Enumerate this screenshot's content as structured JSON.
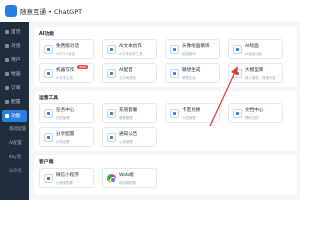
{
  "header": {
    "brand": "随意互通 • ChatGPT"
  },
  "sidebar": {
    "items": [
      {
        "label": "首页"
      },
      {
        "label": "对话"
      },
      {
        "label": "用户"
      },
      {
        "label": "绘画"
      },
      {
        "label": "订单"
      },
      {
        "label": "配置"
      },
      {
        "label": "功能"
      }
    ],
    "sub_items": [
      "基础配置",
      "AI配置",
      "Key池",
      "公众号"
    ]
  },
  "sections": [
    {
      "title": "AI功能",
      "cards": [
        {
          "title": "免费版对话",
          "subtitle": "GPT3.5对话"
        },
        {
          "title": "AI文本创作",
          "subtitle": "AI文本创作工具"
        },
        {
          "title": "头像绘画模块",
          "subtitle": "绘画模块"
        },
        {
          "title": "AI绘画",
          "subtitle": "AI绘画功能"
        },
        {
          "title": "机器写作",
          "subtitle": "AI文本生成",
          "badge": "NEW"
        },
        {
          "title": "AI配音",
          "subtitle": "文字转语音"
        },
        {
          "title": "联想生成",
          "subtitle": "联想生成"
        },
        {
          "title": "大模型库",
          "subtitle": "接入模型，快速问答"
        }
      ]
    },
    {
      "title": "运营工具",
      "cards": [
        {
          "title": "任务中心",
          "subtitle": "任务管理"
        },
        {
          "title": "充值套餐",
          "subtitle": "套餐管理"
        },
        {
          "title": "卡密兑换",
          "subtitle": "卡密管理"
        },
        {
          "title": "文档中心",
          "subtitle": "帮助文档"
        },
        {
          "title": "分享配置",
          "subtitle": "分享设置"
        },
        {
          "title": "通知公告",
          "subtitle": "公告管理"
        }
      ]
    },
    {
      "title": "客户端",
      "cards": [
        {
          "title": "微信小程序",
          "subtitle": "小程序配置"
        },
        {
          "title": "Web端",
          "subtitle": "网页端配置",
          "icon": "chrome-icon"
        }
      ]
    }
  ],
  "colors": {
    "accent": "#2a7de1",
    "sidebar_bg": "#1f2d3d",
    "arrow": "#e53935",
    "badge": "#f04848"
  }
}
